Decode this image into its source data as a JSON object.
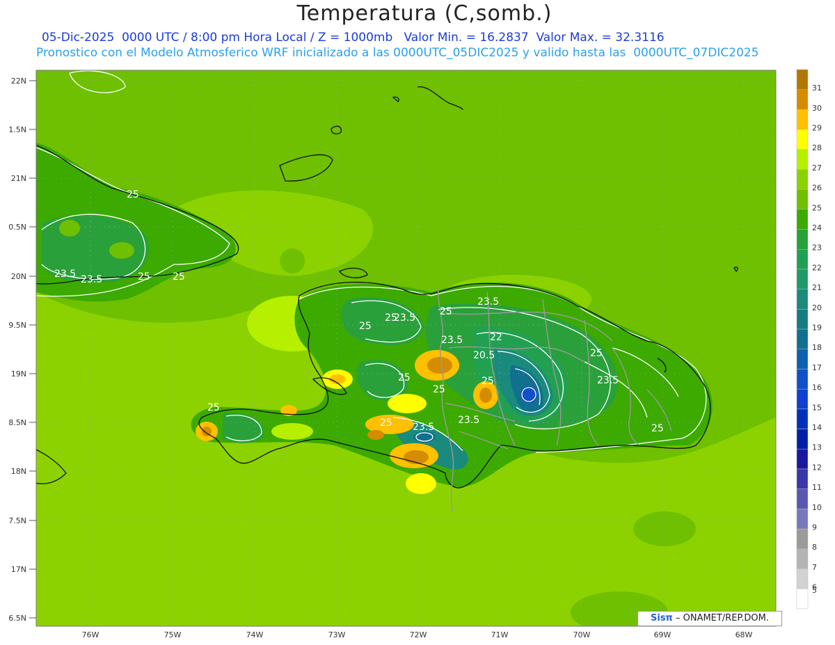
{
  "title": "Temperatura (C,somb.)",
  "subtitle_line1": "05-Dic-2025  0000 UTC / 8:00 pm Hora Local / Z = 1000mb   Valor Min. = 16.2837  Valor Max. = 32.3116",
  "subtitle_line2": "Pronostico con el Modelo Atmosferico WRF inicializado a las 0000UTC_05DIC2025 y valido hasta las  0000UTC_07DIC2025",
  "credit": {
    "logo": "Sisπ",
    "text": " – ONAMET/REP.DOM."
  },
  "axes": {
    "lat_labels": [
      "22N",
      "1.5N",
      "21N",
      "0.5N",
      "20N",
      "9.5N",
      "19N",
      "8.5N",
      "18N",
      "7.5N",
      "17N",
      "6.5N"
    ],
    "lon_labels": [
      "76W",
      "75W",
      "74W",
      "73W",
      "72W",
      "71W",
      "70W",
      "69W",
      "68W"
    ]
  },
  "colorbar": {
    "labels": [
      "31",
      "30",
      "29",
      "28",
      "27",
      "26",
      "25",
      "24",
      "23",
      "22",
      "21",
      "20",
      "19",
      "18",
      "17",
      "16",
      "15",
      "14",
      "13",
      "12",
      "11",
      "10",
      "9",
      "8",
      "7",
      "6",
      "5"
    ],
    "colors": [
      "#b07800",
      "#d58c00",
      "#ffc000",
      "#ffff00",
      "#b6f000",
      "#8cd200",
      "#6ec000",
      "#3caa00",
      "#2aa03a",
      "#22a052",
      "#209a6a",
      "#1a8a7c",
      "#167c84",
      "#10708e",
      "#1060b0",
      "#1050c8",
      "#1040d0",
      "#0030b8",
      "#0020a8",
      "#1818a0",
      "#3838a8",
      "#5858b0",
      "#7878b8",
      "#9a9a9a",
      "#b4b4b4",
      "#d2d2d2",
      "#ffffff"
    ]
  },
  "contour_labels": [
    "25",
    "23.5",
    "23.5",
    "25",
    "25",
    "25",
    "23.5",
    "25",
    "25",
    "23.5",
    "23.5",
    "22",
    "20.5",
    "25",
    "25",
    "25",
    "23.5",
    "25",
    "23.5",
    "25",
    "23.5",
    "25",
    "25"
  ]
}
